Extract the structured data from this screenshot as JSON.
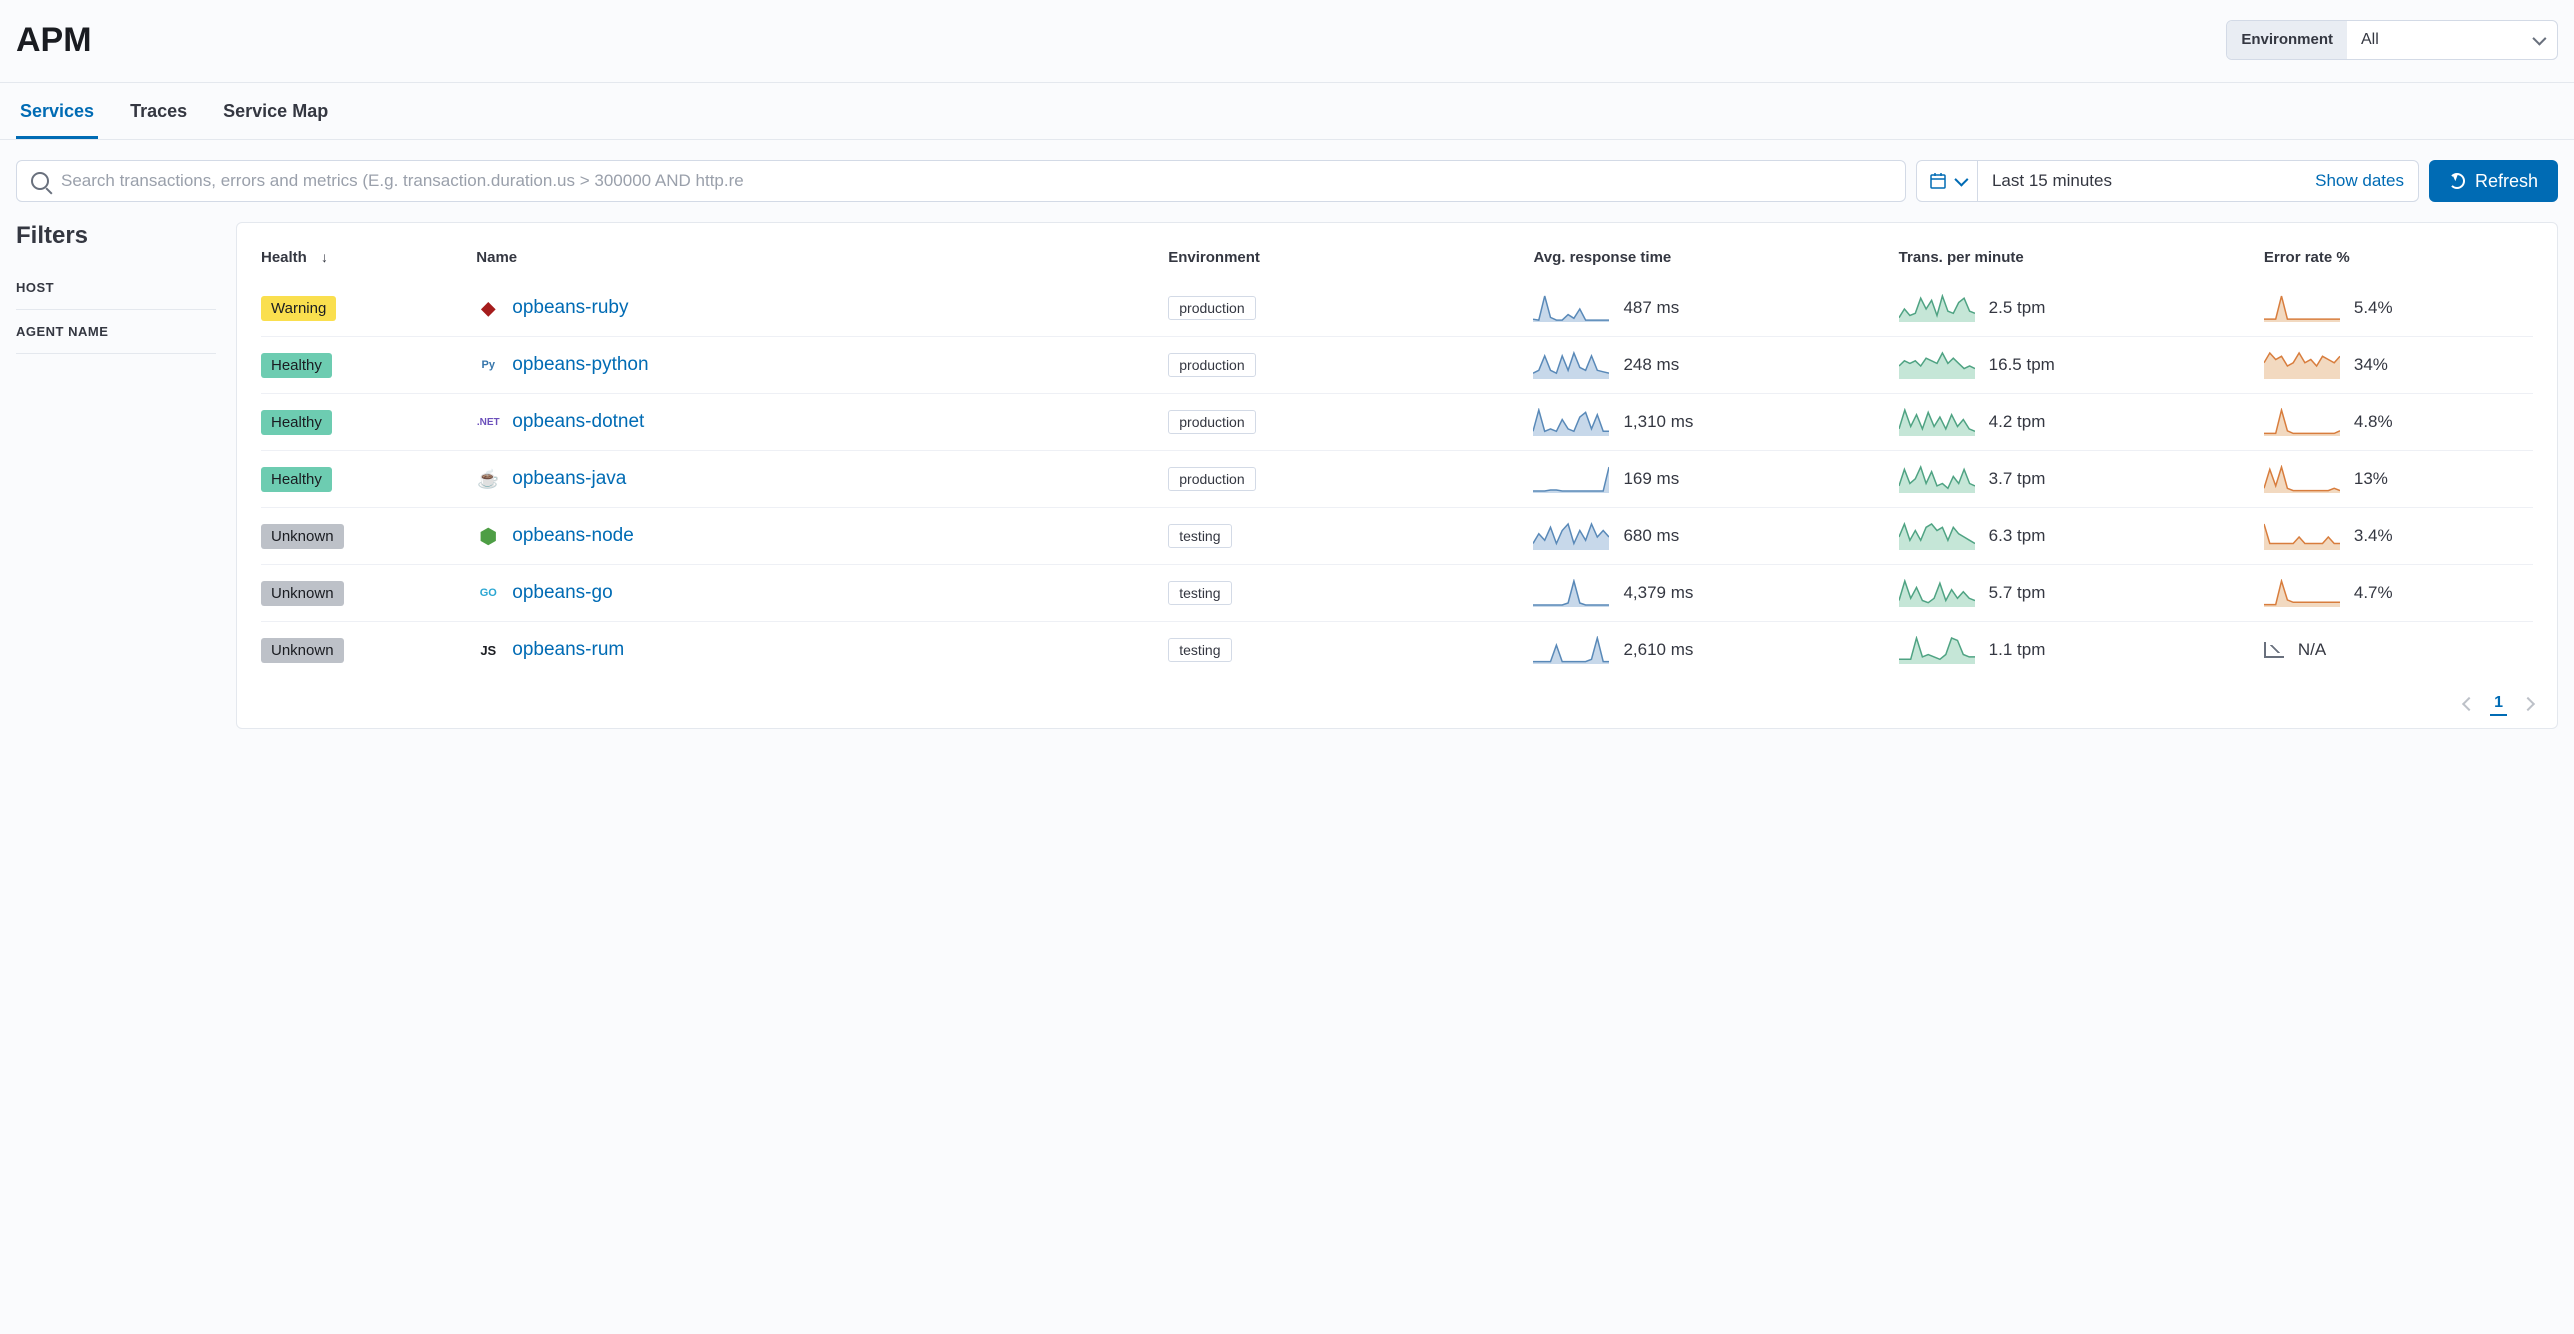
{
  "page": {
    "title": "APM"
  },
  "environment": {
    "label": "Environment",
    "value": "All"
  },
  "tabs": [
    {
      "label": "Services",
      "active": true
    },
    {
      "label": "Traces",
      "active": false
    },
    {
      "label": "Service Map",
      "active": false
    }
  ],
  "search": {
    "placeholder": "Search transactions, errors and metrics (E.g. transaction.duration.us > 300000 AND http.re"
  },
  "date": {
    "quick": "Last 15 minutes",
    "show_dates": "Show dates"
  },
  "refresh": {
    "label": "Refresh"
  },
  "filters": {
    "title": "Filters",
    "sections": [
      {
        "label": "HOST"
      },
      {
        "label": "AGENT NAME"
      }
    ]
  },
  "columns": {
    "health": "Health",
    "name": "Name",
    "env": "Environment",
    "resp": "Avg. response time",
    "tpm": "Trans. per minute",
    "err": "Error rate %"
  },
  "services": [
    {
      "health": "Warning",
      "health_class": "warning",
      "lang_icon": "ruby",
      "name": "opbeans-ruby",
      "env": "production",
      "resp": "487 ms",
      "tpm": "2.5 tpm",
      "err": "5.4%",
      "spark_resp": [
        3,
        2,
        28,
        5,
        2,
        2,
        8,
        4,
        14,
        2,
        2,
        2,
        2,
        2
      ],
      "spark_tpm": [
        4,
        12,
        6,
        8,
        22,
        12,
        20,
        6,
        24,
        10,
        8,
        18,
        22,
        10,
        8
      ],
      "spark_err": [
        2,
        2,
        2,
        18,
        2,
        2,
        2,
        2,
        2,
        2,
        2,
        2,
        2,
        2
      ]
    },
    {
      "health": "Healthy",
      "health_class": "healthy",
      "lang_icon": "python",
      "name": "opbeans-python",
      "env": "production",
      "resp": "248 ms",
      "tpm": "16.5 tpm",
      "err": "34%",
      "spark_resp": [
        4,
        6,
        16,
        6,
        4,
        16,
        6,
        18,
        8,
        6,
        16,
        6,
        5,
        4
      ],
      "spark_tpm": [
        10,
        14,
        12,
        14,
        10,
        16,
        14,
        12,
        20,
        12,
        16,
        12,
        8,
        10,
        8
      ],
      "spark_err": [
        10,
        16,
        12,
        14,
        8,
        10,
        16,
        10,
        12,
        8,
        14,
        12,
        10,
        14
      ]
    },
    {
      "health": "Healthy",
      "health_class": "healthy",
      "lang_icon": "dotnet",
      "name": "opbeans-dotnet",
      "env": "production",
      "resp": "1,310 ms",
      "tpm": "4.2 tpm",
      "err": "4.8%",
      "spark_resp": [
        4,
        22,
        4,
        6,
        4,
        14,
        6,
        4,
        16,
        20,
        6,
        18,
        4,
        4
      ],
      "spark_tpm": [
        6,
        22,
        8,
        18,
        6,
        20,
        8,
        16,
        6,
        18,
        8,
        14,
        6,
        4
      ],
      "spark_err": [
        2,
        2,
        2,
        20,
        4,
        2,
        2,
        2,
        2,
        2,
        2,
        2,
        2,
        4
      ]
    },
    {
      "health": "Healthy",
      "health_class": "healthy",
      "lang_icon": "java",
      "name": "opbeans-java",
      "env": "production",
      "resp": "169 ms",
      "tpm": "3.7 tpm",
      "err": "13%",
      "spark_resp": [
        2,
        2,
        2,
        3,
        3,
        2,
        2,
        2,
        2,
        2,
        2,
        2,
        2,
        26
      ],
      "spark_tpm": [
        6,
        20,
        8,
        12,
        22,
        8,
        18,
        6,
        8,
        4,
        14,
        8,
        20,
        8,
        6
      ],
      "spark_err": [
        4,
        20,
        6,
        22,
        4,
        2,
        2,
        2,
        2,
        2,
        2,
        2,
        4,
        2
      ]
    },
    {
      "health": "Unknown",
      "health_class": "unknown",
      "lang_icon": "node",
      "name": "opbeans-node",
      "env": "testing",
      "resp": "680 ms",
      "tpm": "6.3 tpm",
      "err": "3.4%",
      "spark_resp": [
        4,
        10,
        6,
        14,
        4,
        12,
        16,
        4,
        12,
        6,
        16,
        8,
        12,
        8
      ],
      "spark_tpm": [
        8,
        16,
        6,
        12,
        6,
        14,
        16,
        12,
        14,
        6,
        14,
        10,
        8,
        6,
        4
      ],
      "spark_err": [
        8,
        2,
        2,
        2,
        2,
        2,
        4,
        2,
        2,
        2,
        2,
        4,
        2,
        2
      ]
    },
    {
      "health": "Unknown",
      "health_class": "unknown",
      "lang_icon": "go",
      "name": "opbeans-go",
      "env": "testing",
      "resp": "4,379 ms",
      "tpm": "5.7 tpm",
      "err": "4.7%",
      "spark_resp": [
        2,
        2,
        2,
        2,
        2,
        2,
        4,
        26,
        4,
        2,
        2,
        2,
        2,
        2
      ],
      "spark_tpm": [
        6,
        24,
        8,
        18,
        6,
        4,
        8,
        22,
        6,
        16,
        8,
        14,
        8,
        6
      ],
      "spark_err": [
        2,
        2,
        2,
        22,
        6,
        4,
        4,
        4,
        4,
        4,
        4,
        4,
        4,
        4
      ]
    },
    {
      "health": "Unknown",
      "health_class": "unknown",
      "lang_icon": "js",
      "name": "opbeans-rum",
      "env": "testing",
      "resp": "2,610 ms",
      "tpm": "1.1 tpm",
      "err": "N/A",
      "err_na": true,
      "spark_resp": [
        2,
        2,
        2,
        2,
        16,
        2,
        2,
        2,
        2,
        2,
        4,
        22,
        2,
        2
      ],
      "spark_tpm": [
        4,
        4,
        4,
        22,
        6,
        8,
        6,
        4,
        8,
        22,
        20,
        8,
        6,
        6
      ]
    }
  ],
  "pagination": {
    "current": "1"
  },
  "colors": {
    "resp": {
      "stroke": "#5989b8",
      "fill": "#c7d8ea"
    },
    "tpm": {
      "stroke": "#4fa383",
      "fill": "#c5e6d7"
    },
    "err": {
      "stroke": "#d87d3d",
      "fill": "#f2d9c0"
    }
  },
  "lang_icons": {
    "ruby": {
      "text": "◆",
      "color": "#a51c1c",
      "font_size": "18px"
    },
    "python": {
      "text": "Py",
      "color": "#3776ab"
    },
    "dotnet": {
      "text": ".NET",
      "color": "#6b4fbb",
      "font_size": "10px"
    },
    "java": {
      "text": "☕",
      "color": "#d97b28",
      "font_size": "18px"
    },
    "node": {
      "text": "⬢",
      "color": "#4e9e45",
      "font_size": "20px"
    },
    "go": {
      "text": "GO",
      "color": "#2aa6d2"
    },
    "js": {
      "text": "JS",
      "color": "#1a1c21",
      "font_size": "13px"
    }
  }
}
